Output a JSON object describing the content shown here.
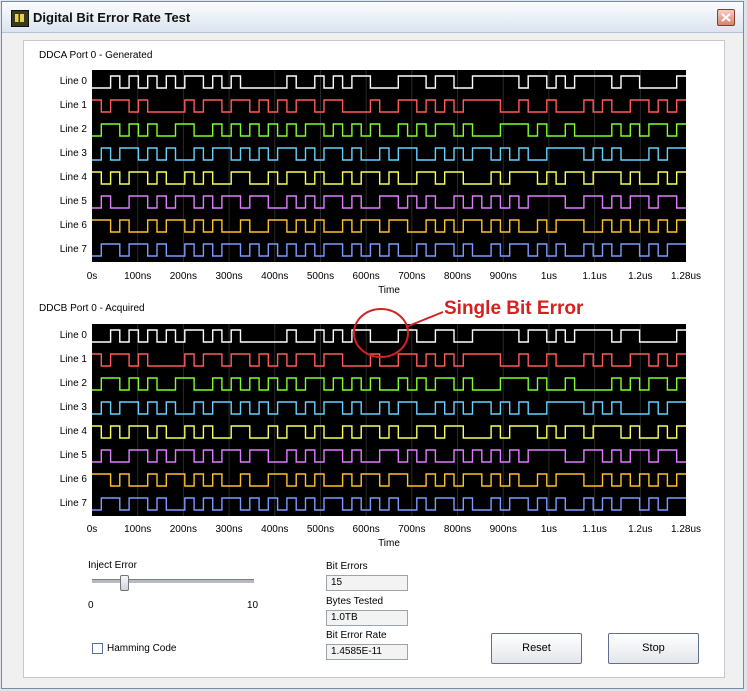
{
  "window": {
    "title": "Digital Bit Error Rate Test"
  },
  "graphs": [
    {
      "title": "DDCA Port 0 - Generated",
      "x_axis_title": "Time",
      "lines": [
        {
          "label": "Line 0",
          "color": "#ffffff",
          "bits": "0010101010110101000001001010110001110110011111011010111101100001"
        },
        {
          "label": "Line 1",
          "color": "#ff5a5a",
          "bits": "1011010000101101101010110110001001101010111100100100010100110101"
        },
        {
          "label": "Line 2",
          "color": "#7cff2a",
          "bits": "0110101001100101010101011010101001010110100011101001000010101101"
        },
        {
          "label": "Line 3",
          "color": "#64d2ff",
          "bits": "0101101010010110101011010110100101100101011010100111101010001011"
        },
        {
          "label": "Line 4",
          "color": "#f7ff5a",
          "bits": "1010110100101001100101101001011010011011000101110101101110100101"
        },
        {
          "label": "Line 5",
          "color": "#e07dff",
          "bits": "0100110101101011011001010110100110101001010101011110011010110110"
        },
        {
          "label": "Line 6",
          "color": "#ffc12a",
          "bits": "1101001011010100100110101001011011001010110101001011100101010101"
        },
        {
          "label": "Line 7",
          "color": "#7d9aff",
          "bits": "0110110100101011010101010110101010010110100101101010010101101011"
        }
      ],
      "ticks": [
        "0s",
        "100ns",
        "200ns",
        "300ns",
        "400ns",
        "500ns",
        "600ns",
        "700ns",
        "800ns",
        "900ns",
        "1us",
        "1.1us",
        "1.2us",
        "1.28us"
      ]
    },
    {
      "title": "DDCB Port 0 - Acquired",
      "x_axis_title": "Time",
      "lines": [
        {
          "label": "Line 0",
          "color": "#ffffff",
          "bits": "0010101010110101000001001010110001100110011111011010111101100001"
        },
        {
          "label": "Line 1",
          "color": "#ff5a5a",
          "bits": "1011010000101101101010110110001001101010111100100100010100110101"
        },
        {
          "label": "Line 2",
          "color": "#7cff2a",
          "bits": "0110101001100101010101011010101001010110100011101001000010101101"
        },
        {
          "label": "Line 3",
          "color": "#64d2ff",
          "bits": "0101101010010110101011010110100101100101011010100111101010001011"
        },
        {
          "label": "Line 4",
          "color": "#f7ff5a",
          "bits": "1010110100101001100101101001011010011011000101110101101110100101"
        },
        {
          "label": "Line 5",
          "color": "#e07dff",
          "bits": "0100110101101011011001010110100110101001010101011110011010110110"
        },
        {
          "label": "Line 6",
          "color": "#ffc12a",
          "bits": "1101001011010100100110101001011011001010110101001011100101010101"
        },
        {
          "label": "Line 7",
          "color": "#7d9aff",
          "bits": "0110110100101011010101010110101010010110100101101010010101101011"
        }
      ],
      "ticks": [
        "0s",
        "100ns",
        "200ns",
        "300ns",
        "400ns",
        "500ns",
        "600ns",
        "700ns",
        "800ns",
        "900ns",
        "1us",
        "1.1us",
        "1.2us",
        "1.28us"
      ]
    }
  ],
  "annotation": {
    "text": "Single Bit Error",
    "color": "#d42121"
  },
  "inject_error": {
    "label": "Inject Error",
    "min": "0",
    "max": "10",
    "value": 2
  },
  "hamming": {
    "label": "Hamming Code",
    "checked": false
  },
  "indicators": {
    "bit_errors_label": "Bit Errors",
    "bit_errors_value": "15",
    "bytes_tested_label": "Bytes Tested",
    "bytes_tested_value": "1.0TB",
    "ber_label": "Bit Error Rate",
    "ber_value": "1.4585E-11"
  },
  "buttons": {
    "reset": "Reset",
    "stop": "Stop"
  }
}
